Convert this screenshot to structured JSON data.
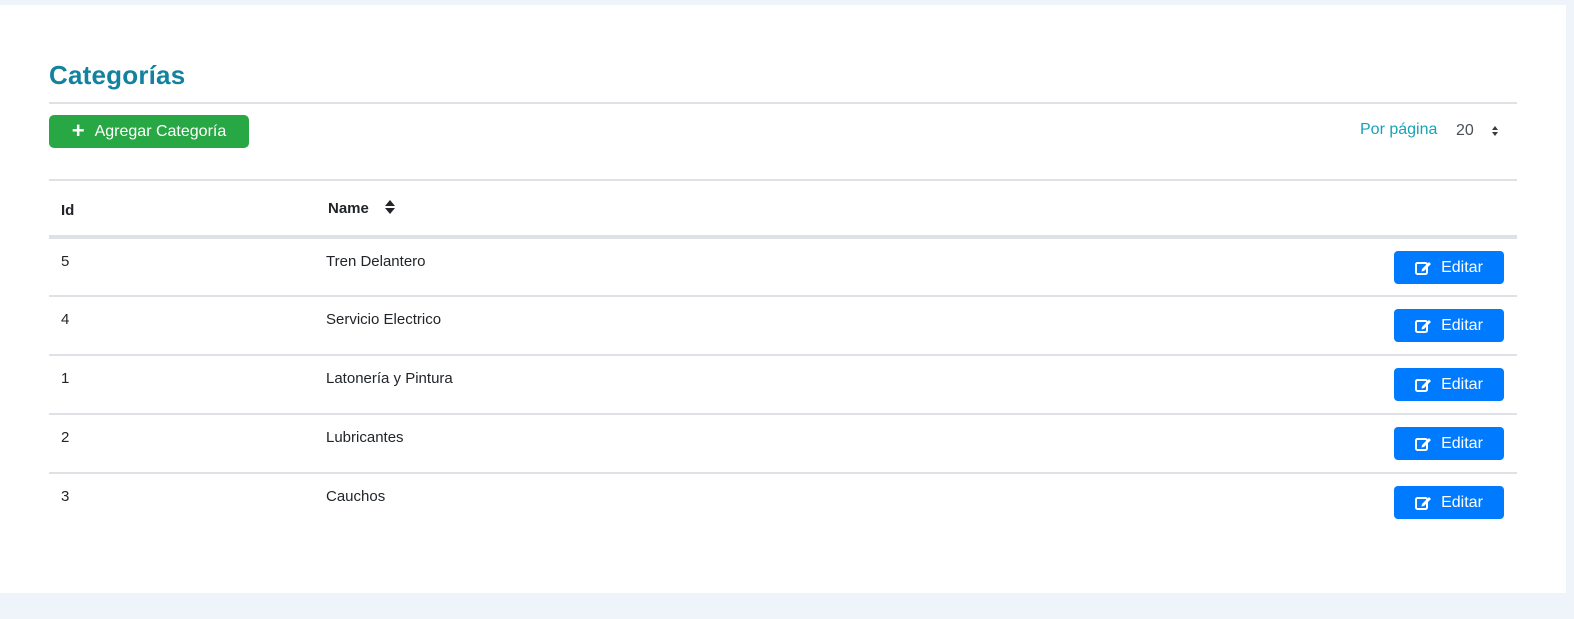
{
  "page": {
    "title": "Categorías"
  },
  "toolbar": {
    "add_label": "Agregar Categoría",
    "add_icon": "plus-icon",
    "per_page_label": "Por página",
    "per_page_value": "20"
  },
  "table": {
    "headers": {
      "id": "Id",
      "name": "Name"
    },
    "rows": [
      {
        "id": "5",
        "name": "Tren Delantero",
        "action": "Editar"
      },
      {
        "id": "4",
        "name": "Servicio Electrico",
        "action": "Editar"
      },
      {
        "id": "1",
        "name": "Latonería y Pintura",
        "action": "Editar"
      },
      {
        "id": "2",
        "name": "Lubricantes",
        "action": "Editar"
      },
      {
        "id": "3",
        "name": "Cauchos",
        "action": "Editar"
      }
    ]
  },
  "colors": {
    "title": "#13829f",
    "add_button": "#28a745",
    "edit_button": "#007bff",
    "per_page_label": "#17a2b8",
    "background": "#eef4f9"
  }
}
